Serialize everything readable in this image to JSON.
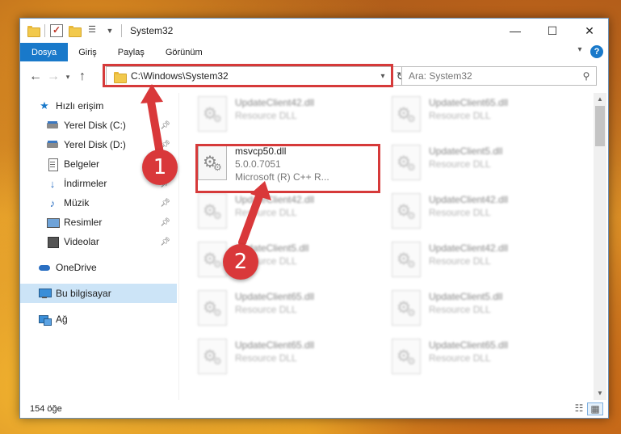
{
  "window": {
    "title": "System32",
    "controls": {
      "minimize": "—",
      "maximize": "☐",
      "close": "✕"
    }
  },
  "ribbon": {
    "file_tab": "Dosya",
    "tabs": [
      "Giriş",
      "Paylaş",
      "Görünüm"
    ],
    "help": "?"
  },
  "nav": {
    "address": "C:\\Windows\\System32",
    "search_placeholder": "Ara: System32"
  },
  "sidebar": {
    "items": [
      {
        "label": "Hızlı erişim",
        "icon": "star-icon"
      },
      {
        "label": "Yerel Disk (C:)",
        "icon": "drive-icon"
      },
      {
        "label": "Yerel Disk (D:)",
        "icon": "drive-icon"
      },
      {
        "label": "Belgeler",
        "icon": "documents-icon"
      },
      {
        "label": "İndirmeler",
        "icon": "download-icon"
      },
      {
        "label": "Müzik",
        "icon": "music-icon"
      },
      {
        "label": "Resimler",
        "icon": "pictures-icon"
      },
      {
        "label": "Videolar",
        "icon": "videos-icon"
      },
      {
        "label": "OneDrive",
        "icon": "cloud-icon"
      },
      {
        "label": "Bu bilgisayar",
        "icon": "computer-icon"
      },
      {
        "label": "Ağ",
        "icon": "network-icon"
      }
    ]
  },
  "files": [
    {
      "name": "UpdateClient42.dll",
      "meta": "Resource DLL"
    },
    {
      "name": "UpdateClient65.dll",
      "meta": "Resource DLL"
    },
    {
      "name": "msvcp50.dll",
      "version": "5.0.0.7051",
      "desc": "Microsoft (R) C++ R..."
    },
    {
      "name": "UpdateClient5.dll",
      "meta": "Resource DLL"
    },
    {
      "name": "UpdateClient42.dll",
      "meta": "Resource DLL"
    },
    {
      "name": "UpdateClient42.dll",
      "meta": "Resource DLL"
    },
    {
      "name": "UpdateClient5.dll",
      "meta": "Resource DLL"
    },
    {
      "name": "UpdateClient42.dll",
      "meta": "Resource DLL"
    },
    {
      "name": "UpdateClient65.dll",
      "meta": "Resource DLL"
    },
    {
      "name": "UpdateClient5.dll",
      "meta": "Resource DLL"
    },
    {
      "name": "UpdateClient65.dll",
      "meta": "Resource DLL"
    },
    {
      "name": "UpdateClient65.dll",
      "meta": "Resource DLL"
    }
  ],
  "status": {
    "count": "154 öğe"
  },
  "annotations": {
    "step1": "1",
    "step2": "2"
  },
  "colors": {
    "accent": "#1979ca",
    "highlight": "#d63a3a",
    "selected": "#cce4f7"
  }
}
